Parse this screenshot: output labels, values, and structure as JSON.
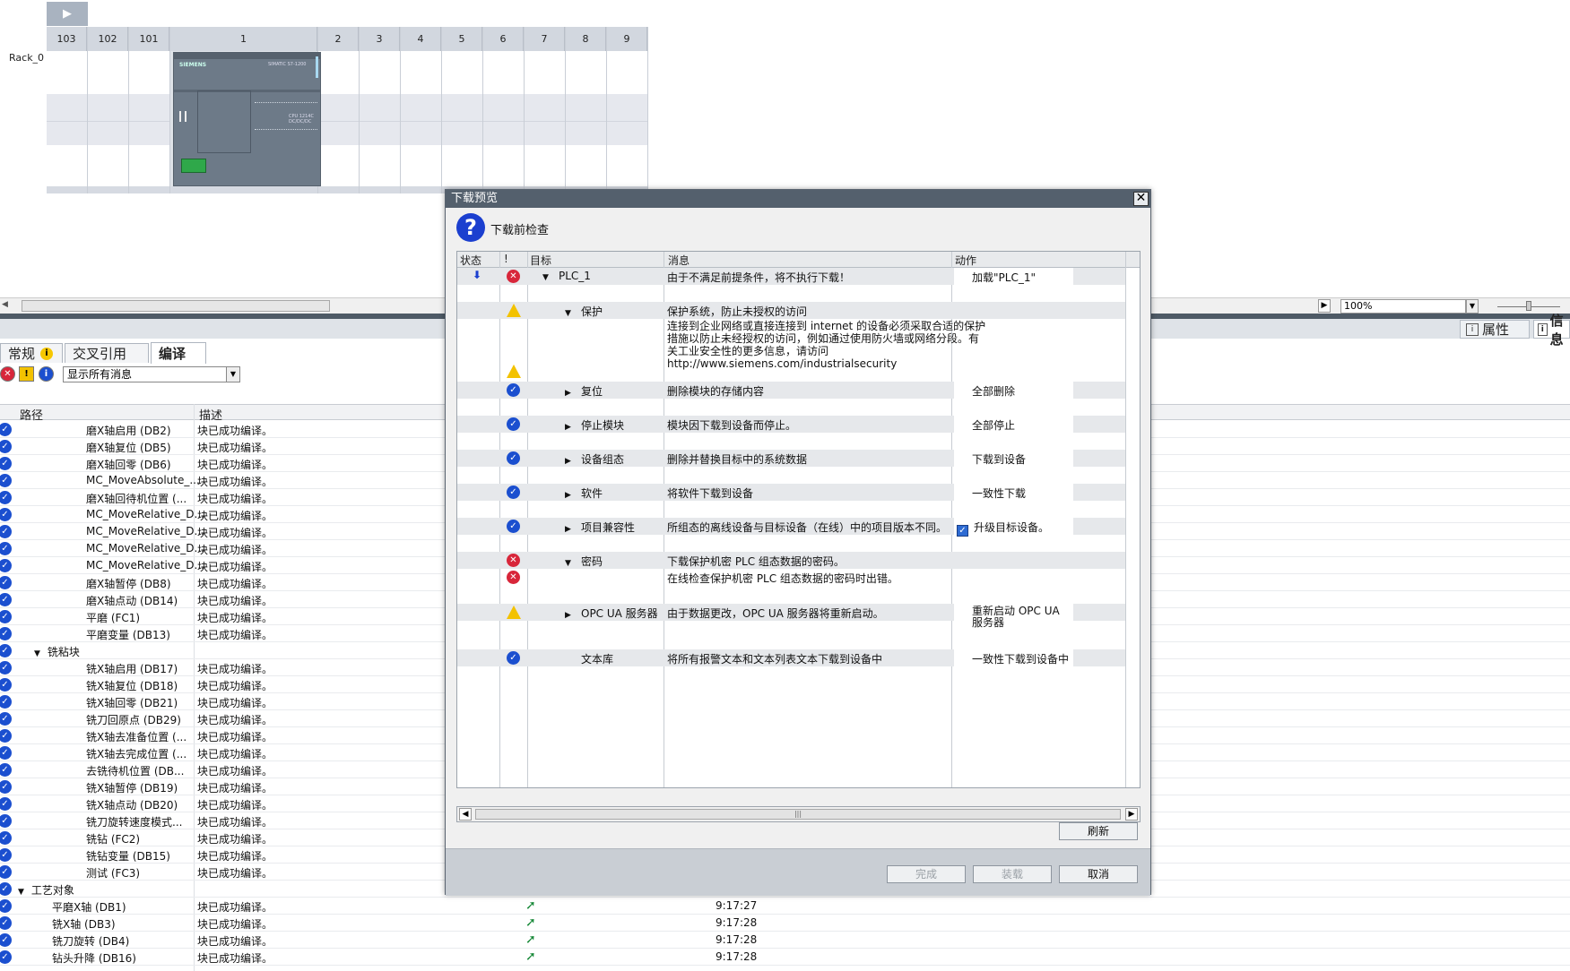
{
  "rack": {
    "play_icon": "play-triangle-icon",
    "label": "Rack_0",
    "slots": [
      "103",
      "102",
      "101",
      "1",
      "2",
      "3",
      "4",
      "5",
      "6",
      "7",
      "8",
      "9"
    ],
    "cpu_brand": "SIEMENS",
    "cpu_model": "SIMATIC S7-1200",
    "cpu_type": "CPU 1214C DC/DC/DC"
  },
  "zoom": {
    "value": "100%"
  },
  "inspector_tabs": {
    "properties": "属性",
    "info": "信息"
  },
  "bottom_tabs": {
    "general": "常规",
    "cross_ref": "交叉引用",
    "compile": "编译"
  },
  "filter": {
    "value": "显示所有消息"
  },
  "list": {
    "col_path": "路径",
    "col_desc": "描述",
    "rows": [
      {
        "path": "磨X轴启用 (DB2)",
        "desc": "块已成功编译。",
        "indent": 3
      },
      {
        "path": "磨X轴复位 (DB5)",
        "desc": "块已成功编译。",
        "indent": 3
      },
      {
        "path": "磨X轴回零 (DB6)",
        "desc": "块已成功编译。",
        "indent": 3
      },
      {
        "path": "MC_MoveAbsolute_...",
        "desc": "块已成功编译。",
        "indent": 3
      },
      {
        "path": "磨X轴回待机位置 (...",
        "desc": "块已成功编译。",
        "indent": 3
      },
      {
        "path": "MC_MoveRelative_D...",
        "desc": "块已成功编译。",
        "indent": 3
      },
      {
        "path": "MC_MoveRelative_D...",
        "desc": "块已成功编译。",
        "indent": 3
      },
      {
        "path": "MC_MoveRelative_D...",
        "desc": "块已成功编译。",
        "indent": 3
      },
      {
        "path": "MC_MoveRelative_D...",
        "desc": "块已成功编译。",
        "indent": 3
      },
      {
        "path": "磨X轴暂停 (DB8)",
        "desc": "块已成功编译。",
        "indent": 3
      },
      {
        "path": "磨X轴点动 (DB14)",
        "desc": "块已成功编译。",
        "indent": 3
      },
      {
        "path": "平磨 (FC1)",
        "desc": "块已成功编译。",
        "indent": 3
      },
      {
        "path": "平磨变量 (DB13)",
        "desc": "块已成功编译。",
        "indent": 3
      },
      {
        "path": "铣粘块",
        "desc": "",
        "indent": 2,
        "expander": true
      },
      {
        "path": "铣X轴启用 (DB17)",
        "desc": "块已成功编译。",
        "indent": 3
      },
      {
        "path": "铣X轴复位 (DB18)",
        "desc": "块已成功编译。",
        "indent": 3
      },
      {
        "path": "铣X轴回零 (DB21)",
        "desc": "块已成功编译。",
        "indent": 3
      },
      {
        "path": "铣刀回原点 (DB29)",
        "desc": "块已成功编译。",
        "indent": 3
      },
      {
        "path": "铣X轴去准备位置 (...",
        "desc": "块已成功编译。",
        "indent": 3
      },
      {
        "path": "铣X轴去完成位置 (...",
        "desc": "块已成功编译。",
        "indent": 3
      },
      {
        "path": "去铣待机位置 (DB...",
        "desc": "块已成功编译。",
        "indent": 3
      },
      {
        "path": "铣X轴暂停 (DB19)",
        "desc": "块已成功编译。",
        "indent": 3
      },
      {
        "path": "铣X轴点动 (DB20)",
        "desc": "块已成功编译。",
        "indent": 3
      },
      {
        "path": "铣刀旋转速度模式...",
        "desc": "块已成功编译。",
        "indent": 3
      },
      {
        "path": "铣钻 (FC2)",
        "desc": "块已成功编译。",
        "indent": 3
      },
      {
        "path": "铣钻变量 (DB15)",
        "desc": "块已成功编译。",
        "indent": 3
      },
      {
        "path": "测试 (FC3)",
        "desc": "块已成功编译。",
        "indent": 3
      },
      {
        "path": "工艺对象",
        "desc": "",
        "indent": 1,
        "expander": true
      },
      {
        "path": "平磨X轴 (DB1)",
        "desc": "块已成功编译。",
        "indent": 2,
        "goto": true,
        "time": "9:17:27"
      },
      {
        "path": "铣X轴 (DB3)",
        "desc": "块已成功编译。",
        "indent": 2,
        "goto": true,
        "time": "9:17:28"
      },
      {
        "path": "铣刀旋转 (DB4)",
        "desc": "块已成功编译。",
        "indent": 2,
        "goto": true,
        "time": "9:17:28"
      },
      {
        "path": "钻头升降 (DB16)",
        "desc": "块已成功编译。",
        "indent": 2,
        "goto": true,
        "time": "9:17:28"
      }
    ]
  },
  "dialog": {
    "title": "下载预览",
    "subtitle": "下载前检查",
    "columns": {
      "status": "状态",
      "excl": "!",
      "target": "目标",
      "message": "消息",
      "action": "动作"
    },
    "rows": [
      {
        "icon": "err",
        "target": "PLC_1",
        "tri": "down",
        "tlevel": 0,
        "message": "由于不满足前提条件，将不执行下载！",
        "action": "加载\"PLC_1\"",
        "shade": true,
        "status_icon": true
      },
      {
        "icon": "warn",
        "target": "保护",
        "tri": "down",
        "tlevel": 1,
        "message": "保护系统，防止未授权的访问",
        "action": "",
        "shade": true
      },
      {
        "icon": "ok",
        "target": "复位",
        "tri": "right",
        "tlevel": 1,
        "message": "删除模块的存储内容",
        "action": "全部删除",
        "shade": true
      },
      {
        "icon": "ok",
        "target": "停止模块",
        "tri": "right",
        "tlevel": 1,
        "message": "模块因下载到设备而停止。",
        "action": "全部停止",
        "shade": true
      },
      {
        "icon": "ok",
        "target": "设备组态",
        "tri": "right",
        "tlevel": 1,
        "message": "删除并替换目标中的系统数据",
        "action": "下载到设备",
        "shade": true
      },
      {
        "icon": "ok",
        "target": "软件",
        "tri": "right",
        "tlevel": 1,
        "message": "将软件下载到设备",
        "action": "一致性下载",
        "shade": true
      },
      {
        "icon": "ok",
        "target": "项目兼容性",
        "tri": "right",
        "tlevel": 1,
        "message": "所组态的离线设备与目标设备（在线）中的项目版本不同。",
        "action": "升级目标设备。",
        "shade": true,
        "checkbox": true
      },
      {
        "icon": "err",
        "target": "密码",
        "tri": "down",
        "tlevel": 1,
        "message": "下载保护机密 PLC 组态数据的密码。",
        "action": "",
        "shade": true
      },
      {
        "icon": "err",
        "target": "",
        "tri": "",
        "tlevel": 2,
        "message": "在线检查保护机密 PLC 组态数据的密码时出错。",
        "action": "",
        "shade": false
      },
      {
        "icon": "warn",
        "target": "OPC UA 服务器",
        "tri": "right",
        "tlevel": 1,
        "message": "由于数据更改，OPC UA 服务器将重新启动。",
        "action": "重新启动 OPC UA 服务器",
        "shade": true
      },
      {
        "icon": "ok",
        "target": "文本库",
        "tri": "",
        "tlevel": 1,
        "message": "将所有报警文本和文本列表文本下载到设备中",
        "action": "一致性下载到设备中",
        "shade": true
      }
    ],
    "protection_note": [
      "连接到企业网络或直接连接到 internet 的设备必须采取合适的保护",
      "措施以防止未经授权的访问，例如通过使用防火墙或网络分段。有",
      "关工业安全性的更多信息，请访问",
      "http://www.siemens.com/industrialsecurity"
    ],
    "buttons": {
      "refresh": "刷新",
      "finish": "完成",
      "load": "装载",
      "cancel": "取消"
    }
  }
}
